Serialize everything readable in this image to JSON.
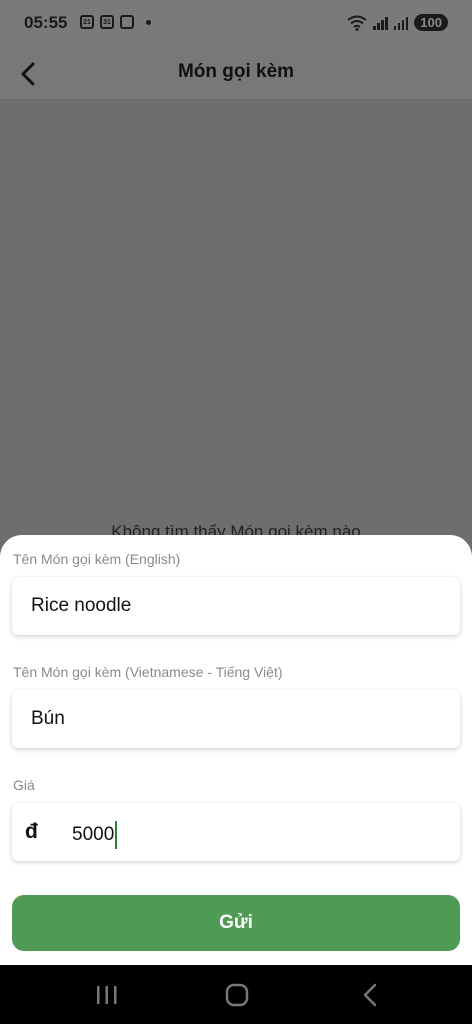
{
  "status": {
    "time": "05:55",
    "left_icons": [
      "21",
      "31",
      "screenshot-icon"
    ],
    "battery": "100"
  },
  "header": {
    "title": "Món gọi kèm",
    "back_icon": "chevron-left-icon"
  },
  "background": {
    "empty_text": "Không tìm thấy Món gọi kèm nào"
  },
  "form": {
    "name_en": {
      "label": "Tên Món gọi kèm (English)",
      "value": "Rice noodle"
    },
    "name_vi": {
      "label": "Tên Món gọi kèm (Vietnamese - Tiếng Việt)",
      "value": "Bún"
    },
    "price": {
      "label": "Giá",
      "currency": "đ",
      "value": "5000"
    },
    "submit_label": "Gửi"
  },
  "colors": {
    "accent": "#4f9a55",
    "caret": "#2e7d32",
    "overlay": "#6e6e6e"
  },
  "nav": [
    "recents-icon",
    "home-icon",
    "back-icon"
  ]
}
